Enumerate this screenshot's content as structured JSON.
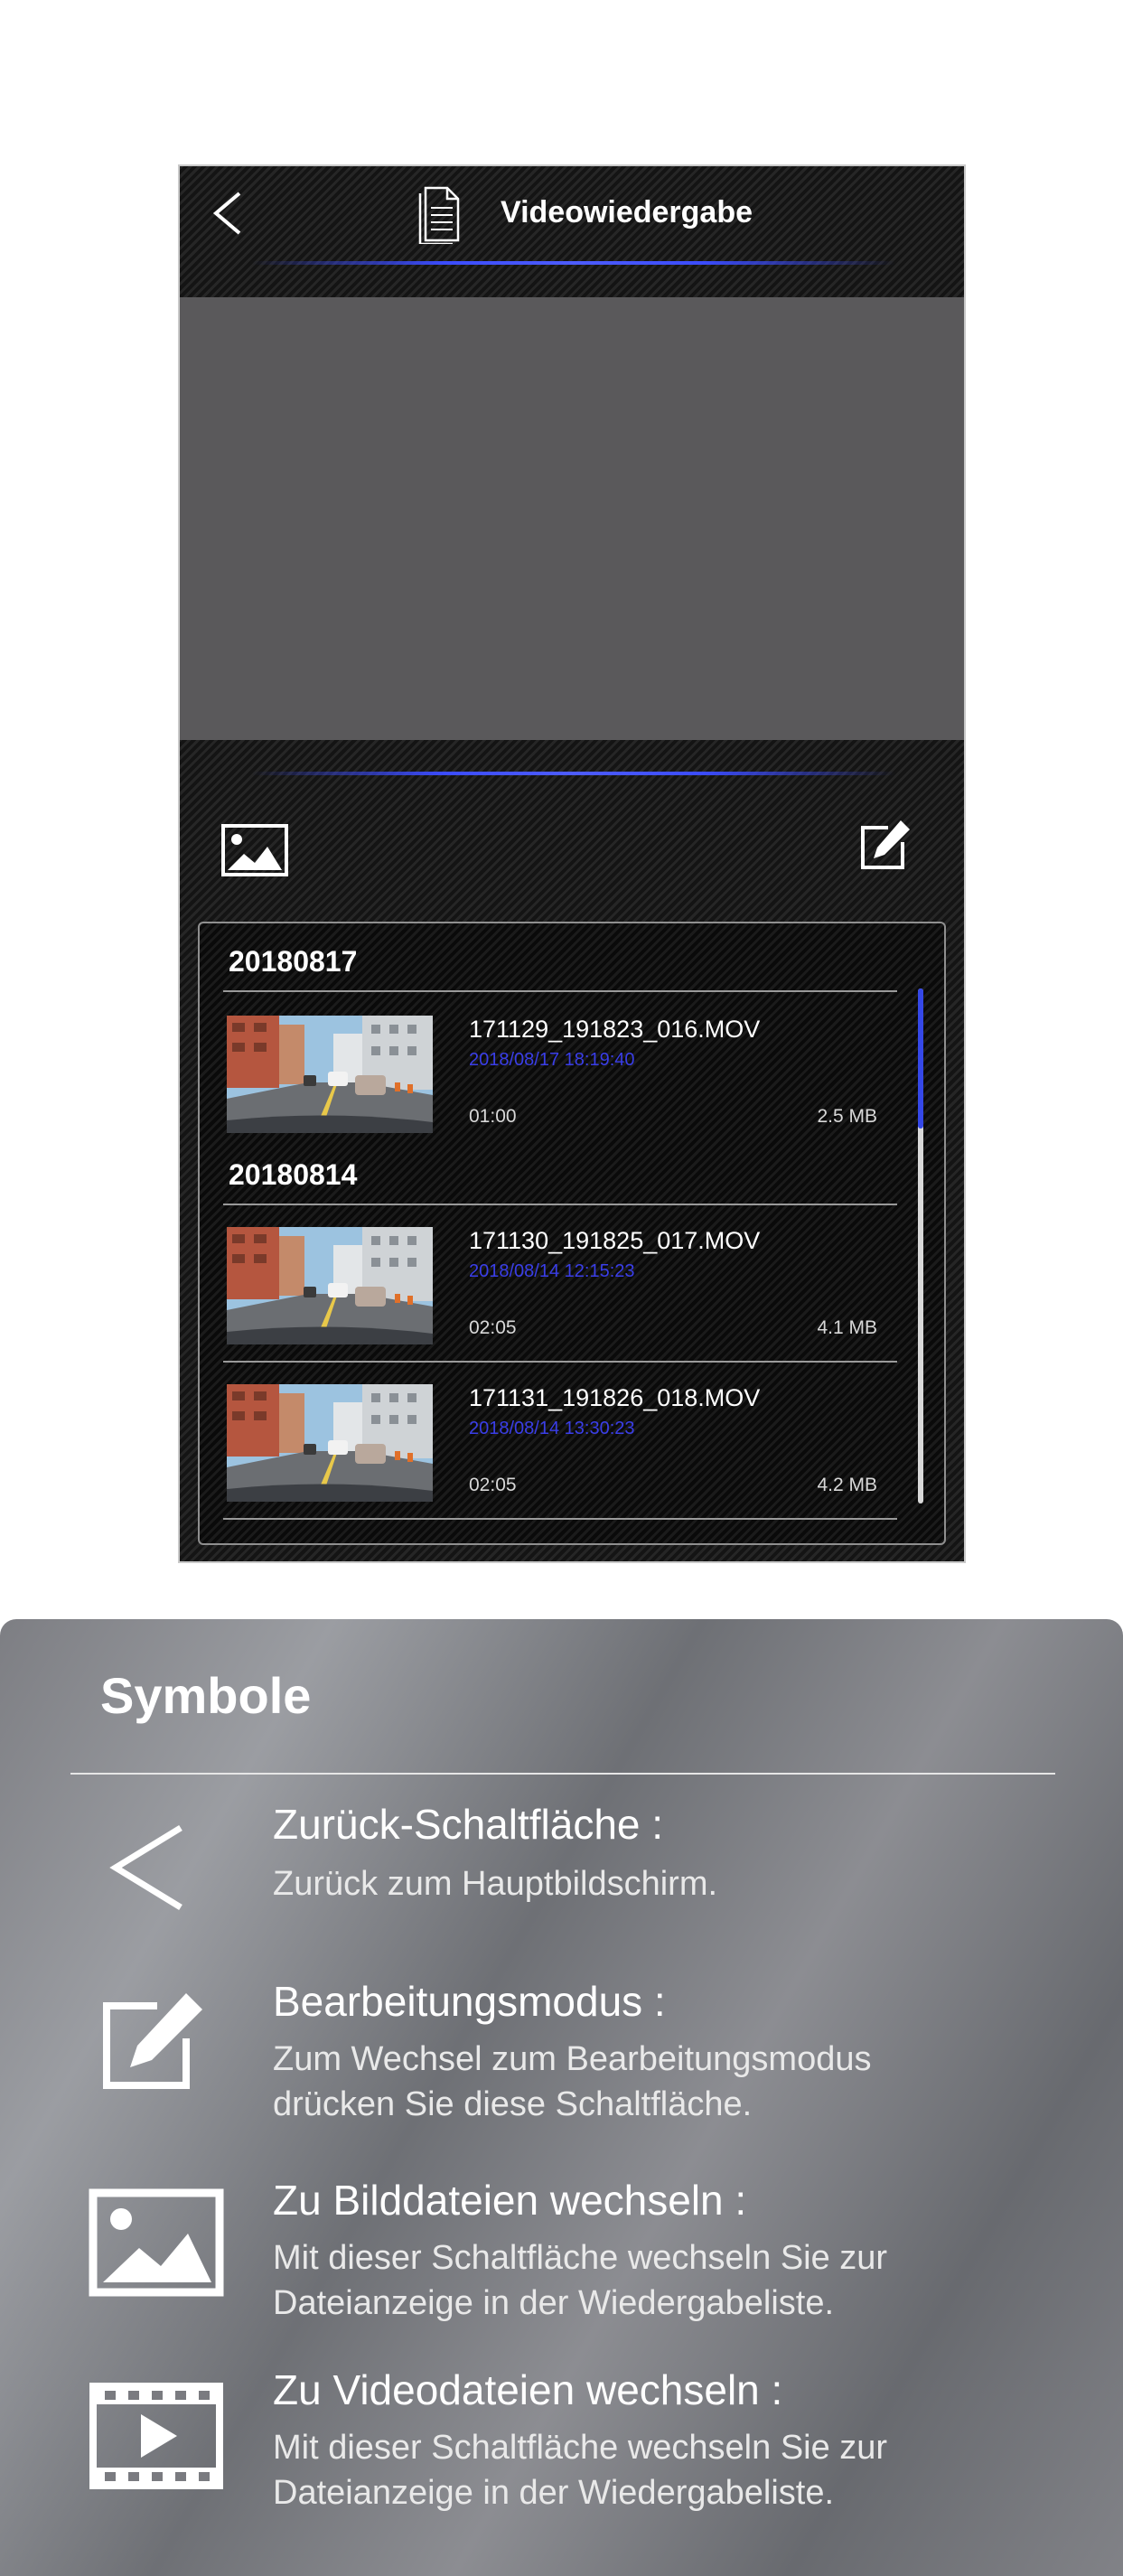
{
  "header": {
    "title": "Videowiedergabe"
  },
  "playlist": {
    "groups": [
      {
        "date": "20180817",
        "items": [
          {
            "filename": "171129_191823_016.MOV",
            "datetime": "2018/08/17 18:19:40",
            "duration": "01:00",
            "size": "2.5 MB"
          }
        ]
      },
      {
        "date": "20180814",
        "items": [
          {
            "filename": "171130_191825_017.MOV",
            "datetime": "2018/08/14 12:15:23",
            "duration": "02:05",
            "size": "4.1 MB"
          },
          {
            "filename": "171131_191826_018.MOV",
            "datetime": "2018/08/14 13:30:23",
            "duration": "02:05",
            "size": "4.2 MB"
          }
        ]
      }
    ]
  },
  "legend": {
    "title": "Symbole",
    "items": [
      {
        "icon": "back-chevron-icon",
        "heading": "Zurück-Schaltfläche :",
        "description": [
          "Zurück zum Hauptbildschirm."
        ]
      },
      {
        "icon": "edit-icon",
        "heading": "Bearbeitungsmodus :",
        "description": [
          "Zum Wechsel zum Bearbeitungsmodus",
          "drücken Sie diese Schaltfläche."
        ]
      },
      {
        "icon": "image-icon",
        "heading": "Zu Bilddateien wechseln :",
        "description": [
          "Mit dieser Schaltfläche wechseln Sie zur",
          "Dateianzeige in der Wiedergabeliste."
        ]
      },
      {
        "icon": "video-icon",
        "heading": "Zu Videodateien wechseln :",
        "description": [
          "Mit dieser Schaltfläche wechseln Sie zur",
          "Dateianzeige in der Wiedergabeliste."
        ]
      }
    ]
  },
  "colors": {
    "accent": "#3b4cff",
    "video_area": "#5a595b",
    "date_text": "#3a3ee8"
  }
}
